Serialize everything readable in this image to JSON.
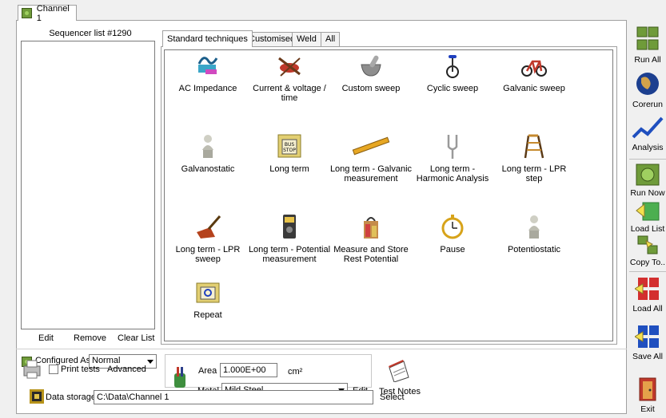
{
  "channel_tab": {
    "label": "Channel 1"
  },
  "sequencer": {
    "title": "Sequencer list #1290",
    "edit": "Edit",
    "remove": "Remove",
    "clear": "Clear List"
  },
  "tabs": [
    "Standard techniques",
    "Customised",
    "Weld",
    "All"
  ],
  "techniques": [
    {
      "label": "AC Impedance",
      "icon": "ac-impedance-icon"
    },
    {
      "label": "Current & voltage / time",
      "icon": "oscilloscope-icon"
    },
    {
      "label": "Custom sweep",
      "icon": "mortar-pestle-icon"
    },
    {
      "label": "Cyclic sweep",
      "icon": "unicycle-icon"
    },
    {
      "label": "Galvanic sweep",
      "icon": "bicycle-icon"
    },
    {
      "label": "Galvanostatic",
      "icon": "statue-icon"
    },
    {
      "label": "Long term",
      "icon": "bus-stop-icon"
    },
    {
      "label": "Long term - Galvanic measurement",
      "icon": "ruler-icon"
    },
    {
      "label": "Long term - Harmonic Analysis",
      "icon": "tuning-fork-icon"
    },
    {
      "label": "Long term - LPR step",
      "icon": "ladder-icon"
    },
    {
      "label": "Long term - LPR sweep",
      "icon": "dustpan-icon"
    },
    {
      "label": "Long term - Potential measurement",
      "icon": "multimeter-icon"
    },
    {
      "label": "Measure and Store Rest Potential",
      "icon": "shopping-bag-icon"
    },
    {
      "label": "Pause",
      "icon": "stopwatch-icon"
    },
    {
      "label": "Potentiostatic",
      "icon": "statue-icon"
    },
    {
      "label": "Repeat",
      "icon": "repeat-folder-icon"
    }
  ],
  "config": {
    "label": "Configured As",
    "value": "Normal",
    "print_tests": "Print tests",
    "advanced": "Advanced"
  },
  "sample": {
    "area_label": "Area",
    "area_value": "1.000E+00",
    "area_unit": "cm²",
    "metal_label": "Metal",
    "metal_value": "Mild Steel",
    "edit": "Edit"
  },
  "test_notes": "Test Notes",
  "data_storage": {
    "label": "Data storage",
    "path": "C:\\Data\\Channel 1",
    "select": "Select"
  },
  "toolbar": {
    "run_all": "Run All",
    "corerun": "Corerun",
    "analysis": "Analysis",
    "run_now": "Run Now",
    "load_list": "Load List",
    "copy_to": "Copy To..",
    "load_all": "Load All",
    "save_all": "Save All",
    "exit": "Exit"
  }
}
